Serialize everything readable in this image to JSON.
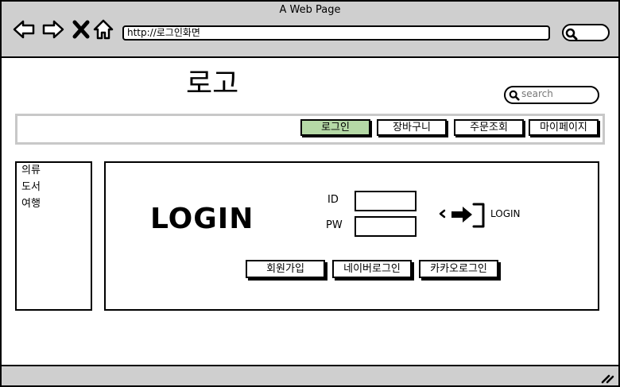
{
  "window": {
    "title": "A Web Page"
  },
  "browser": {
    "url": "http://로그인화면",
    "nav_icons": [
      "back-arrow-icon",
      "forward-arrow-icon",
      "close-x-icon",
      "home-icon"
    ],
    "search_icon": "search-icon"
  },
  "site": {
    "logo": "로고",
    "search_placeholder": "search"
  },
  "menu": {
    "items": [
      {
        "label": "로그인",
        "active": true
      },
      {
        "label": "장바구니",
        "active": false
      },
      {
        "label": "주문조회",
        "active": false
      },
      {
        "label": "마이페이지",
        "active": false
      }
    ],
    "active_color": "#b5d9a6"
  },
  "sidebar": {
    "categories": [
      "의류",
      "도서",
      "여행"
    ]
  },
  "login": {
    "heading": "LOGIN",
    "id_label": "ID",
    "pw_label": "PW",
    "action_label": "LOGIN",
    "action_icon": "sign-in-icon",
    "buttons": [
      "회원가입",
      "네이버로그인",
      "카카오로그인"
    ]
  }
}
